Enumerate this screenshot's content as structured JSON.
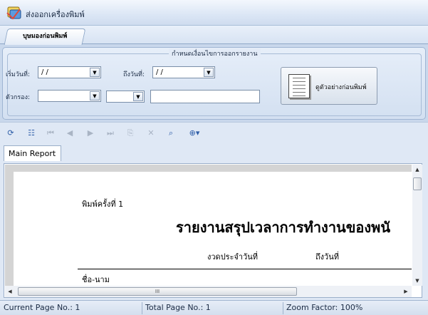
{
  "window": {
    "title": "ส่งออกเครื่องพิมพ์",
    "icon": "printer-app-icon"
  },
  "tabs": [
    {
      "label": "บุษมองก่อนพิมพ์",
      "active": true
    }
  ],
  "criteria": {
    "group_title": "กำหนดเงื่อนไขการออกรายงาน",
    "start_date_label": "เริ่มวันที่:",
    "start_date_value": "/ /",
    "end_date_label": "ถึงวันที่:",
    "end_date_value": "/ /",
    "filter_label": "ตัวกรอง:",
    "filter_value": "",
    "filter_secondary_value": "",
    "filter_text_value": "",
    "preview_button_label": "ดูตัวอย่างก่อนพิมพ์"
  },
  "viewer": {
    "toolbar": [
      {
        "name": "refresh-icon",
        "glyph": "⟳",
        "enabled": true
      },
      {
        "name": "group-tree-icon",
        "glyph": "☷",
        "enabled": true
      },
      {
        "name": "first-page-icon",
        "glyph": "⏮",
        "enabled": false
      },
      {
        "name": "prev-page-icon",
        "glyph": "◀",
        "enabled": false
      },
      {
        "name": "next-page-icon",
        "glyph": "▶",
        "enabled": false
      },
      {
        "name": "last-page-icon",
        "glyph": "⏭",
        "enabled": false
      },
      {
        "name": "goto-page-icon",
        "glyph": "⎘",
        "enabled": false
      },
      {
        "name": "close-view-icon",
        "glyph": "✕",
        "enabled": false
      },
      {
        "name": "find-icon",
        "glyph": "⌕",
        "enabled": true
      },
      {
        "name": "zoom-icon",
        "glyph": "⊕▾",
        "enabled": true
      }
    ],
    "report_tab": "Main Report",
    "report": {
      "print_count": "พิมพ์ครั้งที่ 1",
      "title": "รายงานสรุปเวลาการทำงานของพนั",
      "period_label": "งวดประจำวันที่",
      "to_date_label": "ถึงวันที่",
      "cut_text": "ชื่อ-นาม"
    },
    "scroll_thumb_grip": "III"
  },
  "status": {
    "current_page": "Current Page No.: 1",
    "total_page": "Total Page No.: 1",
    "zoom": "Zoom Factor: 100%"
  }
}
